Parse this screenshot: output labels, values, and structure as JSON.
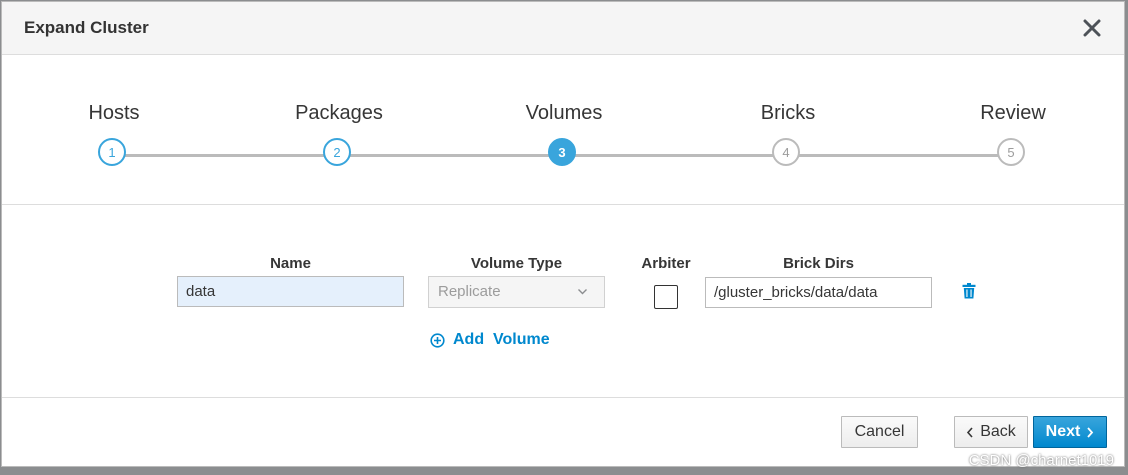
{
  "dialog": {
    "title": "Expand Cluster",
    "close_icon": "close-icon"
  },
  "wizard": {
    "steps": [
      {
        "label": "Hosts",
        "number": "1",
        "state": "complete"
      },
      {
        "label": "Packages",
        "number": "2",
        "state": "complete"
      },
      {
        "label": "Volumes",
        "number": "3",
        "state": "active"
      },
      {
        "label": "Bricks",
        "number": "4",
        "state": "future"
      },
      {
        "label": "Review",
        "number": "5",
        "state": "future"
      }
    ]
  },
  "volumes": {
    "headers": {
      "name": "Name",
      "volume_type": "Volume Type",
      "arbiter": "Arbiter",
      "brick_dirs": "Brick Dirs"
    },
    "rows": [
      {
        "name": "data",
        "volume_type": "Replicate",
        "arbiter": false,
        "brick_dir": "/gluster_bricks/data/data"
      }
    ],
    "add_volume_label": "Add  Volume",
    "delete_icon": "trash-icon"
  },
  "footer": {
    "cancel_label": "Cancel",
    "back_label": "Back",
    "next_label": "Next"
  },
  "watermark": "CSDN @charnet1019",
  "colors": {
    "accent": "#39a5dc",
    "link": "#0088ce",
    "input_highlight": "#e5f0fc"
  }
}
